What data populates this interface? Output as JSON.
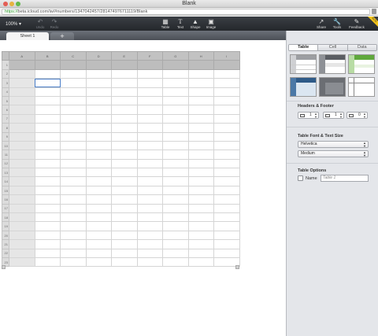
{
  "window": {
    "title": "Blank"
  },
  "browser": {
    "url_scheme": "https://",
    "url_rest": "beta.icloud.com/iw/#numbers/1347042457/281474976711119/Blank"
  },
  "toolbar": {
    "zoom": "100% ▾",
    "undo_label": "Undo",
    "redo_label": "Redo",
    "table_label": "Table",
    "text_label": "Text",
    "shape_label": "Shape",
    "image_label": "Image",
    "share_label": "Share",
    "tools_label": "Tools",
    "feedback_label": "Feedback",
    "beta_badge": "BETA"
  },
  "sheets": {
    "active": "Sheet 1",
    "add_glyph": "+"
  },
  "grid": {
    "columns": [
      "A",
      "B",
      "C",
      "D",
      "E",
      "F",
      "G",
      "H",
      "I"
    ],
    "rows": [
      "1",
      "2",
      "3",
      "4",
      "5",
      "6",
      "7",
      "8",
      "9",
      "10",
      "11",
      "12",
      "13",
      "14",
      "15",
      "16",
      "17",
      "18",
      "19",
      "20",
      "21",
      "22",
      "23"
    ]
  },
  "inspector": {
    "tabs": [
      "Table",
      "Cell",
      "Data"
    ],
    "headers_footer": {
      "title": "Headers & Footer",
      "header_rows": "1",
      "header_cols": "1",
      "footer_rows": "0"
    },
    "font": {
      "title": "Table Font & Text Size",
      "family": "Helvetica",
      "size": "Medium"
    },
    "options": {
      "title": "Table Options",
      "name_label": "Name",
      "name_placeholder": "Table 1"
    },
    "colors": {
      "accent": "#4a7ec8",
      "green": "#5fa83c",
      "blue": "#4b78a6",
      "dark": "#5a5d62"
    }
  }
}
